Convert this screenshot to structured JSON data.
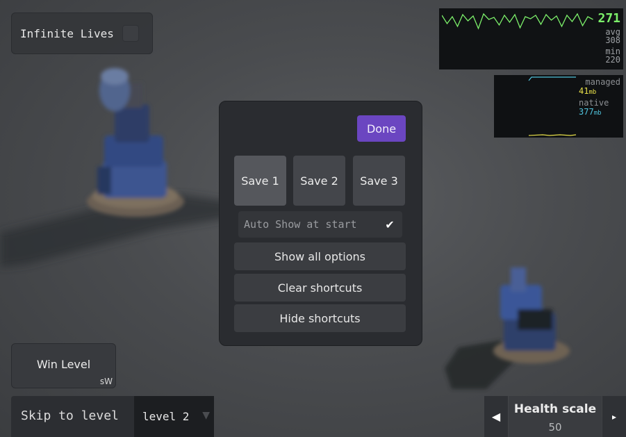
{
  "infinite_lives": {
    "label": "Infinite Lives",
    "checked": false
  },
  "fps_stats": {
    "current": "271",
    "avg_label": "avg",
    "avg_value": "308",
    "min_label": "min",
    "min_value": "220",
    "line_color": "#7cf06a"
  },
  "memory_stats": {
    "managed_label": "managed",
    "managed_value": "41",
    "managed_unit": "mb",
    "native_label": "native",
    "native_value": "377",
    "native_unit": "mb",
    "managed_color": "#e8e04a",
    "native_color": "#4fc3dc"
  },
  "dialog": {
    "done_label": "Done",
    "save_slots": [
      "Save 1",
      "Save 2",
      "Save 3"
    ],
    "auto_show_label": "Auto Show at start",
    "auto_show_checked": true,
    "show_all_label": "Show all options",
    "clear_label": "Clear shortcuts",
    "hide_label": "Hide shortcuts"
  },
  "win_level": {
    "label": "Win Level",
    "shortcut": "sW"
  },
  "skip_level": {
    "label": "Skip to level",
    "selected": "level 2"
  },
  "health_scale": {
    "label": "Health scale",
    "value": "50"
  },
  "colors": {
    "accent": "#6b46c1",
    "panel": "#2a2c30"
  }
}
